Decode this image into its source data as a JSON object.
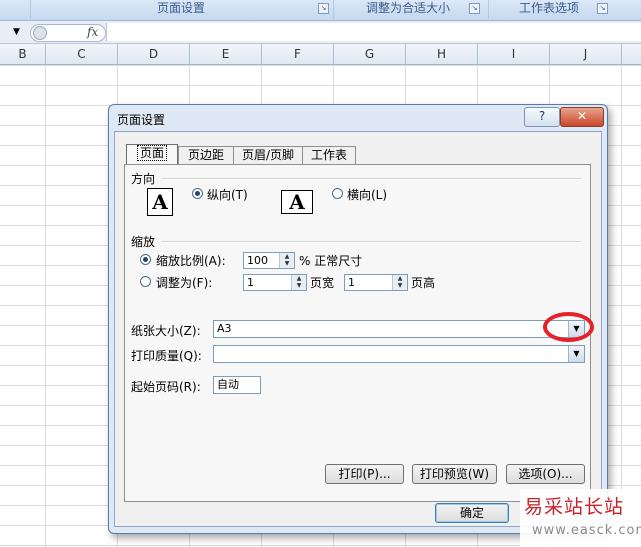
{
  "ribbon": {
    "groups": [
      {
        "label": "页面设置"
      },
      {
        "label": "调整为合适大小"
      },
      {
        "label": "工作表选项"
      }
    ]
  },
  "formula_bar": {
    "fx_label": "fx"
  },
  "columns": [
    "B",
    "C",
    "D",
    "E",
    "F",
    "G",
    "H",
    "I",
    "J"
  ],
  "dialog": {
    "title": "页面设置",
    "help": "?",
    "close": "✕",
    "tabs": [
      "页面",
      "页边距",
      "页眉/页脚",
      "工作表"
    ],
    "active_tab": "页面",
    "orientation": {
      "section_label": "方向",
      "portrait_label": "纵向(T)",
      "landscape_label": "横向(L)",
      "selected": "portrait",
      "icon_glyph": "A"
    },
    "scaling": {
      "section_label": "缩放",
      "adjust_to_label": "缩放比例(A):",
      "adjust_to_value": "100",
      "percent_suffix": "% 正常尺寸",
      "fit_to_label": "调整为(F):",
      "pages_wide_value": "1",
      "pages_wide_label": "页宽",
      "pages_tall_value": "1",
      "pages_tall_label": "页高",
      "selected": "adjust_to"
    },
    "paper_size": {
      "label": "纸张大小(Z):",
      "value": "A3"
    },
    "print_quality": {
      "label": "打印质量(Q):",
      "value": ""
    },
    "first_page_number": {
      "label": "起始页码(R):",
      "value": "自动"
    },
    "buttons": {
      "print": "打印(P)...",
      "print_preview": "打印预览(W)",
      "options": "选项(O)...",
      "ok": "确定"
    }
  },
  "watermark": {
    "text": "易采站长站",
    "url": "www.easck.com"
  }
}
